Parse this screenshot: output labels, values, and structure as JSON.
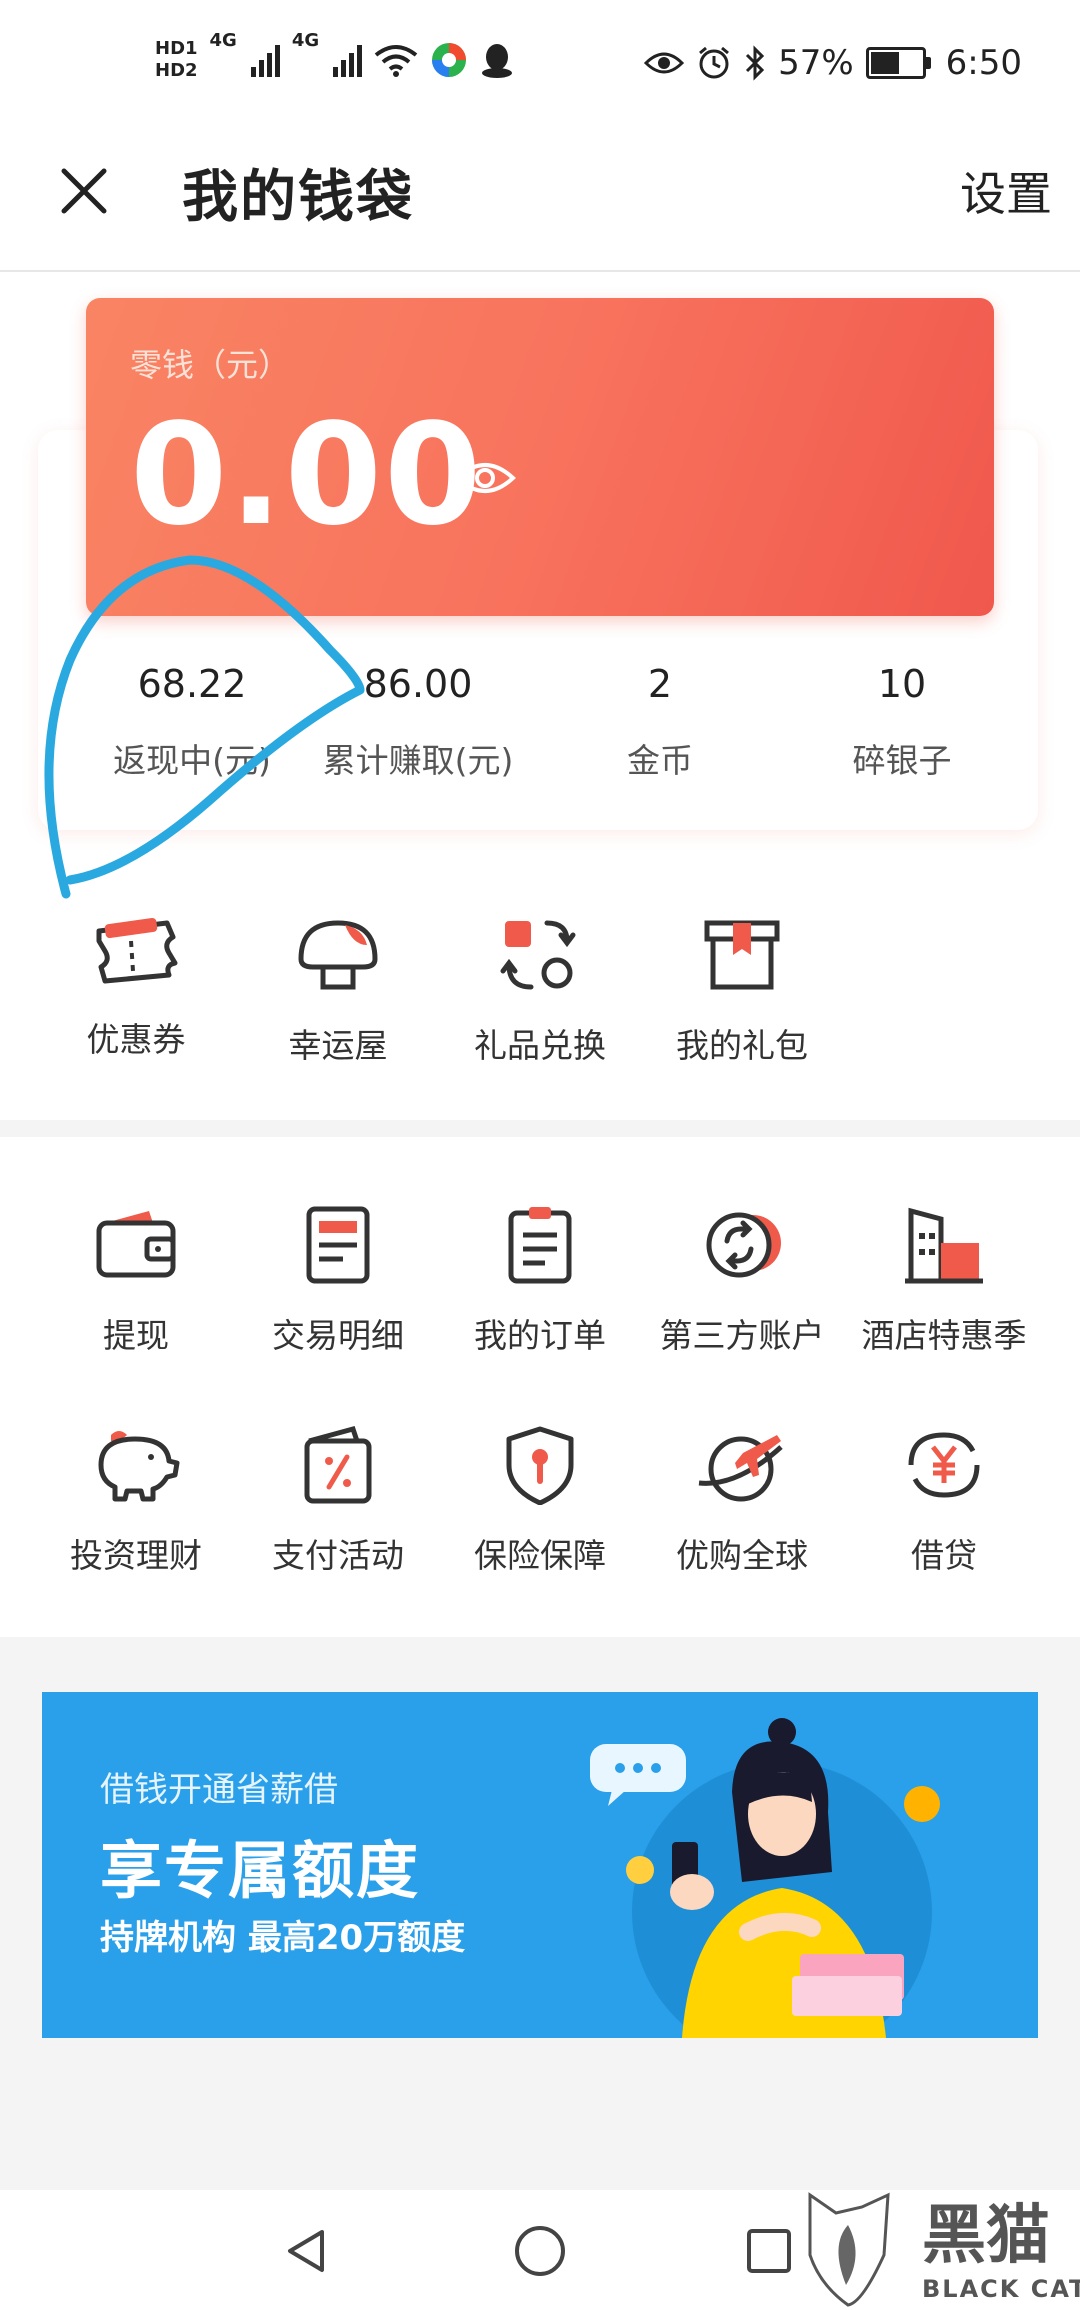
{
  "status_bar": {
    "hd1": "HD1",
    "hd2": "HD2",
    "net1": "4G",
    "net2": "4G",
    "battery_percent": "57%",
    "battery_level": 0.57,
    "time": "6:50"
  },
  "header": {
    "title": "我的钱袋",
    "settings_label": "设置"
  },
  "balance": {
    "label": "零钱（元）",
    "amount": "0.00"
  },
  "stats": [
    {
      "value": "68.22",
      "label": "返现中(元)"
    },
    {
      "value": "86.00",
      "label": "累计赚取(元)"
    },
    {
      "value": "2",
      "label": "金币"
    },
    {
      "value": "10",
      "label": "碎银子"
    }
  ],
  "quick_links": [
    {
      "label": "优惠券",
      "icon": "ticket-icon"
    },
    {
      "label": "幸运屋",
      "icon": "mushroom-icon"
    },
    {
      "label": "礼品兑换",
      "icon": "gift-exchange-icon"
    },
    {
      "label": "我的礼包",
      "icon": "gift-box-icon"
    }
  ],
  "services": [
    {
      "label": "提现",
      "icon": "wallet-icon"
    },
    {
      "label": "交易明细",
      "icon": "transaction-detail-icon"
    },
    {
      "label": "我的订单",
      "icon": "order-clipboard-icon"
    },
    {
      "label": "第三方账户",
      "icon": "third-party-account-icon"
    },
    {
      "label": "酒店特惠季",
      "icon": "hotel-icon"
    },
    {
      "label": "投资理财",
      "icon": "piggy-bank-icon"
    },
    {
      "label": "支付活动",
      "icon": "payment-discount-icon"
    },
    {
      "label": "保险保障",
      "icon": "insurance-shield-icon"
    },
    {
      "label": "优购全球",
      "icon": "global-shopping-icon"
    },
    {
      "label": "借贷",
      "icon": "loan-yen-icon"
    }
  ],
  "banner": {
    "subtitle": "借钱开通省薪借",
    "title": "享专属额度",
    "description": "持牌机构 最高20万额度"
  },
  "colors": {
    "accent": "#f05a4a",
    "card_gradient_start": "#f98463",
    "card_gradient_end": "#f0584d",
    "banner_blue": "#2aa0ea",
    "annotation_blue": "#29a9e0"
  },
  "watermark": {
    "text_cn": "黑猫",
    "text_en": "BLACK CAT"
  }
}
